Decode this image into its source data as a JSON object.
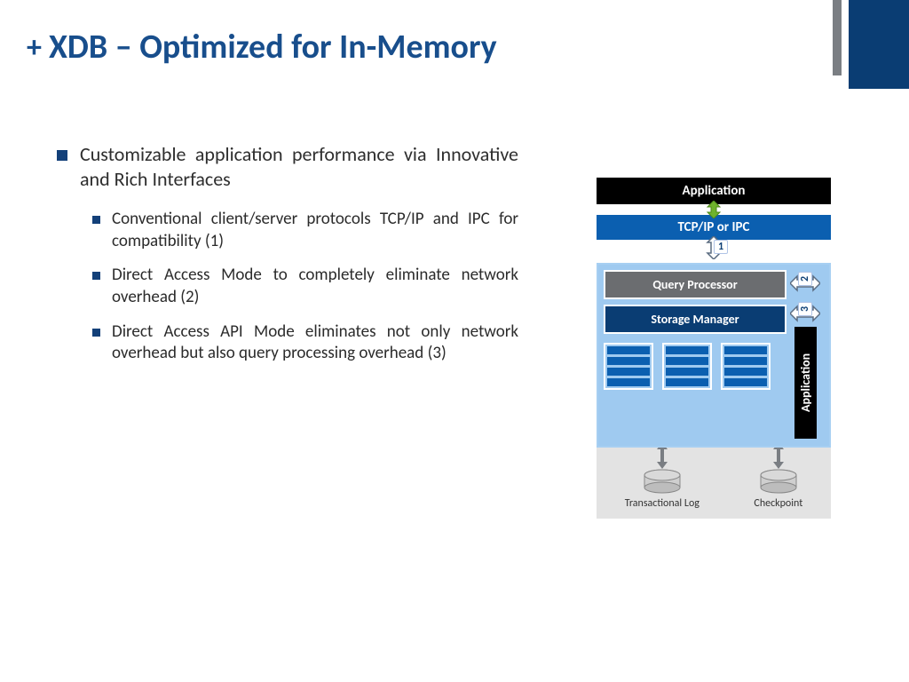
{
  "title": "XDB – Optimized for In-Memory",
  "bullet_main": "Customizable application performance via Innovative and Rich Interfaces",
  "sub_bullets": [
    "Conventional client/server  protocols TCP/IP and IPC for compatibility (1)",
    "Direct Access Mode to completely eliminate network overhead (2)",
    "Direct Access API Mode eliminates not only network overhead but also query processing overhead (3)"
  ],
  "diagram": {
    "app_top": "Application",
    "ipc": "TCP/IP or IPC",
    "qp": "Query Processor",
    "sm": "Storage Manager",
    "app_side": "Application",
    "txlog": "Transactional Log",
    "checkpoint": "Checkpoint",
    "badge1": "1",
    "badge2": "2",
    "badge3": "3"
  },
  "colors": {
    "title_blue": "#184e8c",
    "dark_blue": "#0a3d73",
    "bright_blue": "#0b5fb0",
    "light_blue": "#9fcaf0",
    "gray_box": "#6b6d70"
  }
}
